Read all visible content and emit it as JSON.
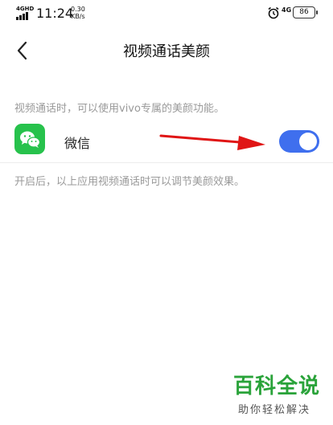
{
  "status_bar": {
    "network_label": "4GHD",
    "time": "11:24",
    "speed_value": "0.30",
    "speed_unit": "KB/s",
    "network_right": "4G",
    "battery": "86"
  },
  "header": {
    "title": "视频通话美颜"
  },
  "description": "视频通话时，可以使用vivo专属的美颜功能。",
  "apps": [
    {
      "name": "微信",
      "enabled": true
    }
  ],
  "note": "开启后，以上应用视频通话时可以调节美颜效果。",
  "watermark": {
    "title": "百科全说",
    "subtitle": "助你轻松解决"
  },
  "colors": {
    "accent": "#3f6fee",
    "wechat_green": "#27c24c",
    "watermark_green": "#2aa33a",
    "annotation_red": "#e01515"
  }
}
